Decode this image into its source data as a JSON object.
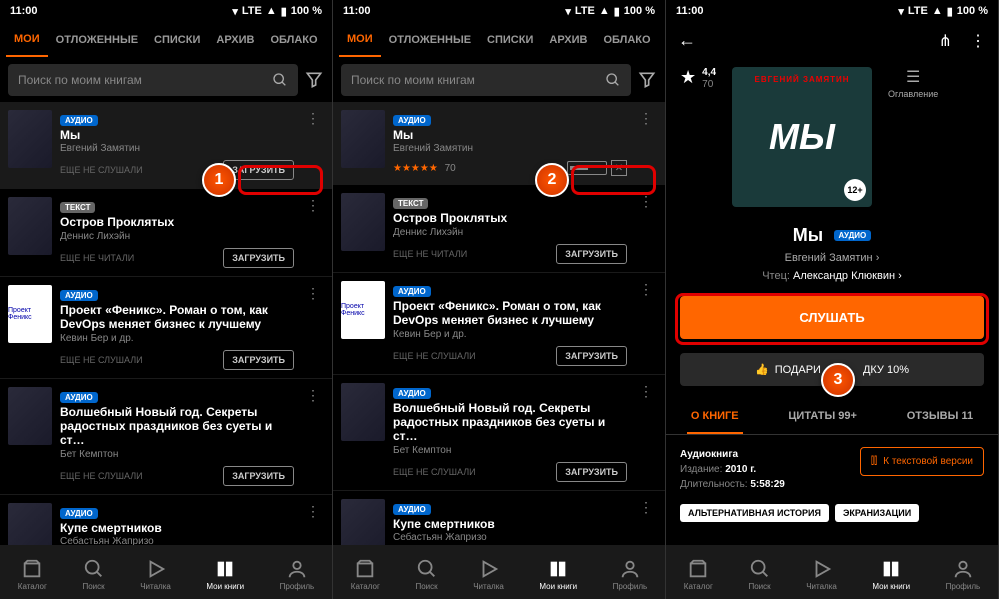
{
  "status": {
    "time": "11:00",
    "lte": "LTE",
    "battery": "100 %"
  },
  "tabs": [
    "МОИ",
    "ОТЛОЖЕННЫЕ",
    "СПИСКИ",
    "АРХИВ",
    "ОБЛАКО"
  ],
  "search_placeholder": "Поиск по моим книгам",
  "download_label": "ЗАГРУЗИТЬ",
  "books": [
    {
      "badge": "АУДИО",
      "title": "Мы",
      "author": "Евгений Замятин",
      "status": "ЕЩЕ НЕ СЛУШАЛИ",
      "rating": "70"
    },
    {
      "badge": "ТЕКСТ",
      "title": "Остров Проклятых",
      "author": "Деннис Лихэйн",
      "status": "ЕЩЕ НЕ ЧИТАЛИ"
    },
    {
      "badge": "АУДИО",
      "title": "Проект «Феникс». Роман о том, как DevOps меняет бизнес к лучшему",
      "author": "Кевин Бер и др.",
      "status": "ЕЩЕ НЕ СЛУШАЛИ"
    },
    {
      "badge": "АУДИО",
      "title": "Волшебный Новый год. Секреты радостных праздников без суеты и ст…",
      "author": "Бет Кемптон",
      "status": "ЕЩЕ НЕ СЛУШАЛИ"
    },
    {
      "badge": "АУДИО",
      "title": "Купе смертников",
      "author": "Себастьян Жапризо"
    }
  ],
  "nav": [
    "Каталог",
    "Поиск",
    "Читалка",
    "Мои книги",
    "Профиль"
  ],
  "detail": {
    "cover_author": "ЕВГЕНИЙ ЗАМЯТИН",
    "cover_title": "МЫ",
    "age": "12+",
    "rating": "4,4",
    "rating_count": "70",
    "toc": "Оглавление",
    "title": "Мы",
    "badge": "АУДИО",
    "author": "Евгений Замятин",
    "reader_label": "Чтец:",
    "reader_name": "Александр Клюквин",
    "listen": "СЛУШАТЬ",
    "gift": "ПОДАРИ",
    "gift2": "ДКУ 10%",
    "tabs": [
      "О КНИГЕ",
      "ЦИТАТЫ 99+",
      "ОТЗЫВЫ 11"
    ],
    "meta_type": "Аудиокнига",
    "meta_edition_label": "Издание:",
    "meta_edition": "2010 г.",
    "meta_duration_label": "Длительность:",
    "meta_duration": "5:58:29",
    "text_version": "К текстовой версии",
    "tags": [
      "АЛЬТЕРНАТИВНАЯ ИСТОРИЯ",
      "ЭКРАНИЗАЦИИ"
    ]
  },
  "markers": [
    "1",
    "2",
    "3"
  ]
}
